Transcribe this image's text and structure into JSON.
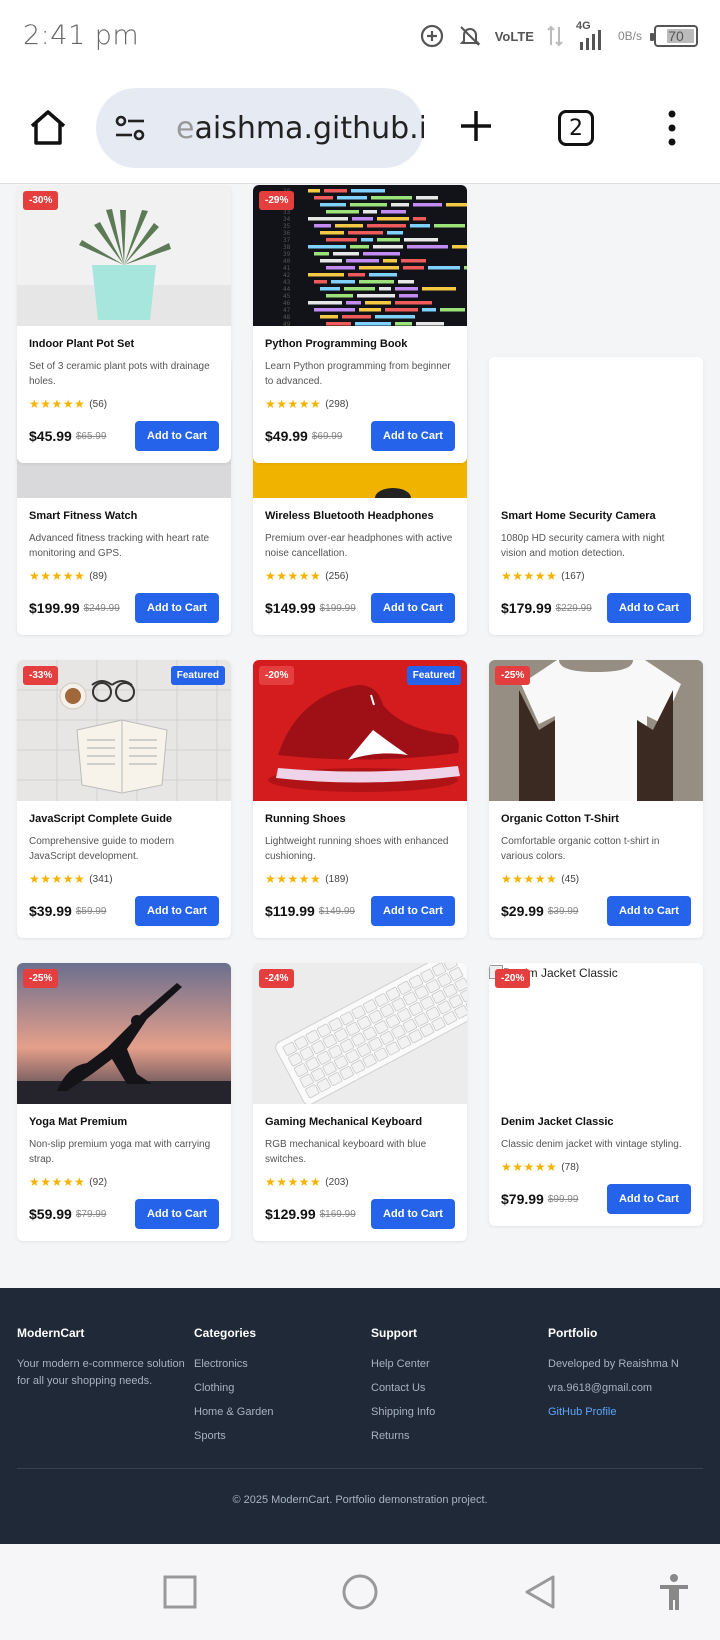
{
  "status_bar": {
    "time": "2:41 pm",
    "volte_top": "Vo",
    "volte_bottom": "LTE",
    "network": "4G",
    "speed_value": "0",
    "speed_unit": "B/s",
    "battery": "70",
    "battery_level": 0.7
  },
  "browser": {
    "url_faded": "e",
    "url": "aishma.github.io",
    "tab_count": "2"
  },
  "products": [
    {
      "title": "Smart Fitness Watch",
      "desc": "Advanced fitness tracking with heart rate monitoring and GPS.",
      "stars": "★★★★★",
      "rating": 4.5,
      "reviews": "(89)",
      "price": "$199.99",
      "old_price": "$249.99",
      "button": "Add to Cart",
      "badge": "",
      "featured": "",
      "image": "fitness-watch-image"
    },
    {
      "title": "Wireless Bluetooth Headphones",
      "desc": "Premium over-ear headphones with active noise cancellation.",
      "stars": "★★★★★",
      "rating": 4.5,
      "reviews": "(256)",
      "price": "$149.99",
      "old_price": "$199.99",
      "button": "Add to Cart",
      "badge": "",
      "featured": "",
      "image": "headphones-image"
    },
    {
      "title": "Smart Home Security Camera",
      "desc": "1080p HD security camera with night vision and motion detection.",
      "stars": "★★★★★",
      "rating": 4.5,
      "reviews": "(167)",
      "price": "$179.99",
      "old_price": "$229.99",
      "button": "Add to Cart",
      "badge": "",
      "featured": "",
      "image": "security-camera-image"
    },
    {
      "title": "JavaScript Complete Guide",
      "desc": "Comprehensive guide to modern JavaScript development.",
      "stars": "★★★★★",
      "rating": 4.5,
      "reviews": "(341)",
      "price": "$39.99",
      "old_price": "$59.99",
      "button": "Add to Cart",
      "badge": "-33%",
      "featured": "Featured",
      "image": "book-image"
    },
    {
      "title": "Running Shoes",
      "desc": "Lightweight running shoes with enhanced cushioning.",
      "stars": "★★★★★",
      "rating": 4.5,
      "reviews": "(189)",
      "price": "$119.99",
      "old_price": "$149.99",
      "button": "Add to Cart",
      "badge": "-20%",
      "featured": "Featured",
      "image": "shoe-image"
    },
    {
      "title": "Organic Cotton T-Shirt",
      "desc": "Comfortable organic cotton t-shirt in various colors.",
      "stars": "★★★★★",
      "rating": 4.5,
      "reviews": "(45)",
      "price": "$29.99",
      "old_price": "$39.99",
      "button": "Add to Cart",
      "badge": "-25%",
      "featured": "",
      "image": "tshirt-image"
    },
    {
      "title": "Yoga Mat Premium",
      "desc": "Non-slip premium yoga mat with carrying strap.",
      "stars": "★★★★★",
      "rating": 4.5,
      "reviews": "(92)",
      "price": "$59.99",
      "old_price": "$79.99",
      "button": "Add to Cart",
      "badge": "-25%",
      "featured": "",
      "image": "yoga-image"
    },
    {
      "title": "Gaming Mechanical Keyboard",
      "desc": "RGB mechanical keyboard with blue switches.",
      "stars": "★★★★★",
      "rating": 4.5,
      "reviews": "(203)",
      "price": "$129.99",
      "old_price": "$169.99",
      "button": "Add to Cart",
      "badge": "-24%",
      "featured": "",
      "image": "keyboard-image"
    },
    {
      "title": "Denim Jacket Classic",
      "desc": "Classic denim jacket with vintage styling.",
      "stars": "★★★★★",
      "rating": 4.5,
      "reviews": "(78)",
      "price": "$79.99",
      "old_price": "$99.99",
      "button": "Add to Cart",
      "badge": "-20%",
      "featured": "",
      "image": "broken-image",
      "alt": "Denim Jacket Classic"
    },
    {
      "title": "Indoor Plant Pot Set",
      "desc": "Set of 3 ceramic plant pots with drainage holes.",
      "stars": "★★★★★",
      "rating": 4.5,
      "reviews": "(56)",
      "price": "$45.99",
      "old_price": "$65.99",
      "button": "Add to Cart",
      "badge": "-30%",
      "featured": "",
      "image": "plant-image"
    },
    {
      "title": "Python Programming Book",
      "desc": "Learn Python programming from beginner to advanced.",
      "stars": "★★★★★",
      "rating": 4.5,
      "reviews": "(298)",
      "price": "$49.99",
      "old_price": "$69.99",
      "button": "Add to Cart",
      "badge": "-29%",
      "featured": "",
      "image": "code-image"
    }
  ],
  "footer": {
    "brand": {
      "heading": "ModernCart",
      "text": "Your modern e-commerce solution for all your shopping needs."
    },
    "categories": {
      "heading": "Categories",
      "links": [
        "Electronics",
        "Clothing",
        "Home & Garden",
        "Sports"
      ]
    },
    "support": {
      "heading": "Support",
      "links": [
        "Help Center",
        "Contact Us",
        "Shipping Info",
        "Returns"
      ]
    },
    "portfolio": {
      "heading": "Portfolio",
      "developer": "Developed by Reaishma N",
      "email": "vra.9618@gmail.com",
      "github": "GitHub Profile"
    },
    "copyright": "© 2025 ModernCart. Portfolio demonstration project."
  },
  "colors": {
    "accent": "#2563eb",
    "badge": "#e53e3e",
    "footer_bg": "#1f2937",
    "star": "#f5b301",
    "link": "#60a5fa"
  }
}
